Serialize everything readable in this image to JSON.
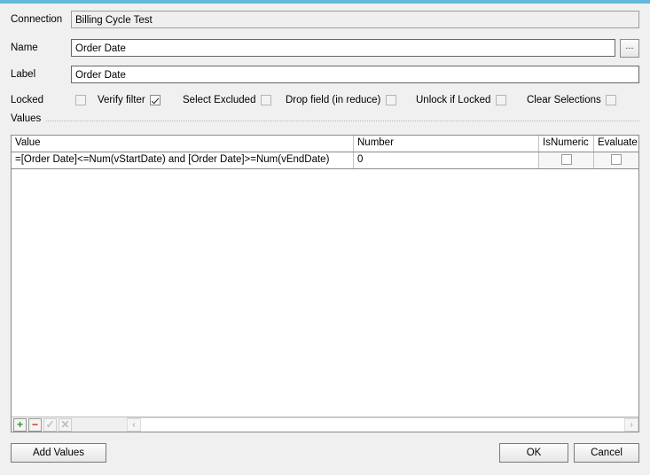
{
  "window": {
    "accent_color": "#63b8dc",
    "background_color": "#f0f0f0"
  },
  "form": {
    "connection": {
      "label": "Connection",
      "value": "Billing Cycle Test"
    },
    "name": {
      "label": "Name",
      "value": "Order Date",
      "browse_label": "..."
    },
    "label_field": {
      "label": "Label",
      "value": "Order Date"
    }
  },
  "options": {
    "locked_label": "Locked",
    "items": [
      {
        "label": "Verify filter",
        "checked": true
      },
      {
        "label": "Select Excluded",
        "checked": false
      },
      {
        "label": "Drop field (in reduce)",
        "checked": false
      },
      {
        "label": "Unlock if Locked",
        "checked": false
      },
      {
        "label": "Clear Selections",
        "checked": false
      }
    ]
  },
  "values_group": {
    "title": "Values",
    "columns": [
      "Value",
      "Number",
      "IsNumeric",
      "Evaluate"
    ],
    "rows": [
      {
        "value": "=[Order Date]<=Num(vStartDate) and [Order Date]>=Num(vEndDate)",
        "number": "0",
        "is_numeric": false,
        "evaluate": false
      }
    ],
    "toolbar": {
      "add": "+",
      "remove": "−",
      "confirm": "✓",
      "cancel": "✕"
    },
    "scroll": {
      "left_arrow": "‹",
      "right_arrow": "›"
    }
  },
  "footer": {
    "add_values": "Add Values",
    "ok": "OK",
    "cancel": "Cancel"
  }
}
